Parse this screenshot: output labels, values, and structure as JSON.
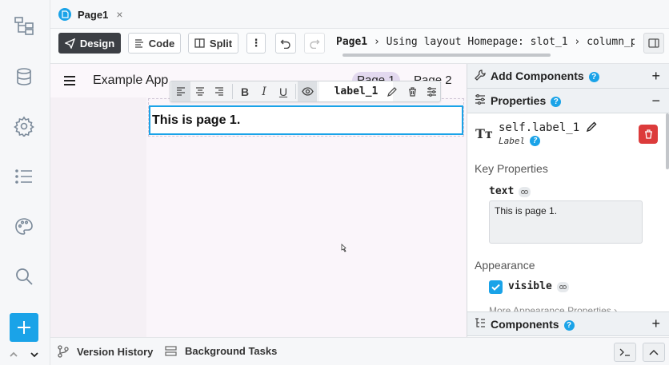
{
  "tabs": [
    {
      "label": "Page1",
      "close": "×"
    }
  ],
  "toolbar": {
    "design_label": "Design",
    "code_label": "Code",
    "split_label": "Split",
    "more_label": "⋮",
    "breadcrumb_root": "Page1",
    "breadcrumb_rest": " › Using layout Homepage: slot_1 › column_p"
  },
  "app": {
    "title": "Example App",
    "nav": [
      "Page 1",
      "Page 2"
    ],
    "label_text": "This is page 1."
  },
  "floating_toolbar": {
    "component_name": "label_1",
    "icons": [
      "align-left-icon",
      "align-center-icon",
      "align-right-icon",
      "bold-icon",
      "italic-icon",
      "underline-icon",
      "eye-icon",
      "pencil-icon",
      "trash-icon",
      "sliders-icon"
    ]
  },
  "right_panel": {
    "add_components": "Add Components",
    "properties": "Properties",
    "component_name": "self.label_1",
    "component_type": "Label",
    "key_properties": "Key Properties",
    "text_prop_label": "text",
    "text_prop_value": "This is page 1.",
    "appearance": "Appearance",
    "visible_label": "visible",
    "more_appearance": "More Appearance Properties ›",
    "components": "Components",
    "help": "?",
    "plus": "+",
    "minus": "−"
  },
  "bottom": {
    "version_history": "Version History",
    "background_tasks": "Background Tasks"
  },
  "colors": {
    "accent": "#1aa3e8",
    "primary_button": "#3c3f44",
    "delete": "#dc3b3b",
    "canvas_bg": "#faf5fa",
    "nav_active": "#e3d9ef"
  }
}
